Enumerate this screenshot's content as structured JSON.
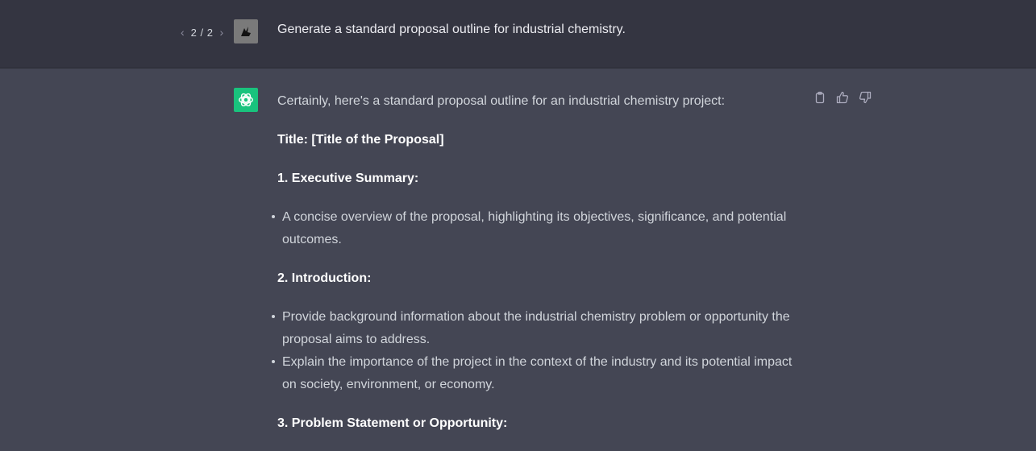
{
  "user_message": {
    "pager": {
      "prev": "‹",
      "count": "2 / 2",
      "next": "›"
    },
    "text": "Generate a standard proposal outline for industrial chemistry."
  },
  "assistant_message": {
    "intro": "Certainly, here's a standard proposal outline for an industrial chemistry project:",
    "title_line": "Title: [Title of the Proposal]",
    "sections": [
      {
        "heading": "1. Executive Summary:",
        "bullets": [
          "A concise overview of the proposal, highlighting its objectives, significance, and potential outcomes."
        ]
      },
      {
        "heading": "2. Introduction:",
        "bullets": [
          "Provide background information about the industrial chemistry problem or opportunity the proposal aims to address.",
          "Explain the importance of the project in the context of the industry and its potential impact on society, environment, or economy."
        ]
      },
      {
        "heading": "3. Problem Statement or Opportunity:",
        "bullets": []
      }
    ]
  },
  "icons": {
    "user_avatar": "user-avatar-icon",
    "assistant_avatar": "openai-logo-icon",
    "copy": "clipboard-icon",
    "thumbs_up": "thumbs-up-icon",
    "thumbs_down": "thumbs-down-icon"
  },
  "colors": {
    "user_bg": "#343541",
    "assistant_bg": "#444654",
    "assistant_avatar_bg": "#19c37d"
  }
}
